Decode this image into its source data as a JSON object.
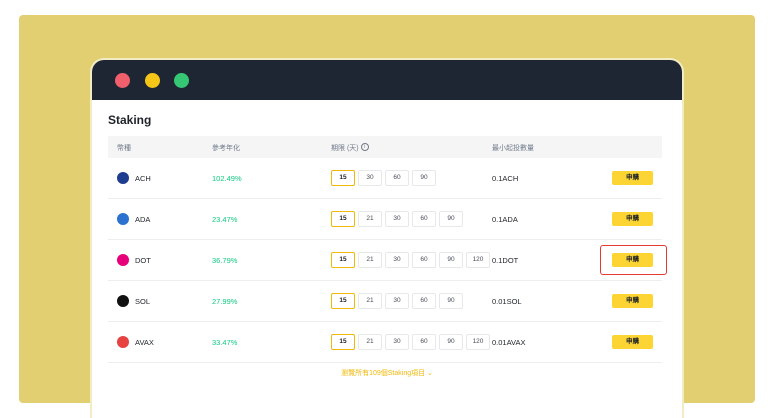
{
  "window": {
    "title": "Staking"
  },
  "table": {
    "headers": {
      "coin": "幣種",
      "apy": "參考年化",
      "duration": "期限 (天)",
      "min": "最小起投數量"
    },
    "info_icon": "i"
  },
  "rows": [
    {
      "coin": "ACH",
      "icon": "ach-icon",
      "icon_color": "#1f3d8f",
      "apy": "102.49%",
      "durations": [
        "15",
        "30",
        "60",
        "90"
      ],
      "min": "0.1ACH",
      "button": "申購"
    },
    {
      "coin": "ADA",
      "icon": "ada-icon",
      "icon_color": "#2a71d0",
      "apy": "23.47%",
      "durations": [
        "15",
        "21",
        "30",
        "60",
        "90"
      ],
      "min": "0.1ADA",
      "button": "申購"
    },
    {
      "coin": "DOT",
      "icon": "dot-icon",
      "icon_color": "#e6007a",
      "apy": "36.79%",
      "durations": [
        "15",
        "21",
        "30",
        "60",
        "90",
        "120"
      ],
      "min": "0.1DOT",
      "button": "申購"
    },
    {
      "coin": "SOL",
      "icon": "sol-icon",
      "icon_color": "#111111",
      "apy": "27.99%",
      "durations": [
        "15",
        "21",
        "30",
        "60",
        "90"
      ],
      "min": "0.01SOL",
      "button": "申購"
    },
    {
      "coin": "AVAX",
      "icon": "avax-icon",
      "icon_color": "#e84142",
      "apy": "33.47%",
      "durations": [
        "15",
        "21",
        "30",
        "60",
        "90",
        "120"
      ],
      "min": "0.01AVAX",
      "button": "申購"
    }
  ],
  "footer": {
    "view_all": "瀏覽所有109個Staking項目 ⌄"
  },
  "colors": {
    "accent": "#fcd535",
    "positive": "#0ecb81",
    "titlebar": "#1f2633",
    "backdrop": "#e2cf72"
  }
}
